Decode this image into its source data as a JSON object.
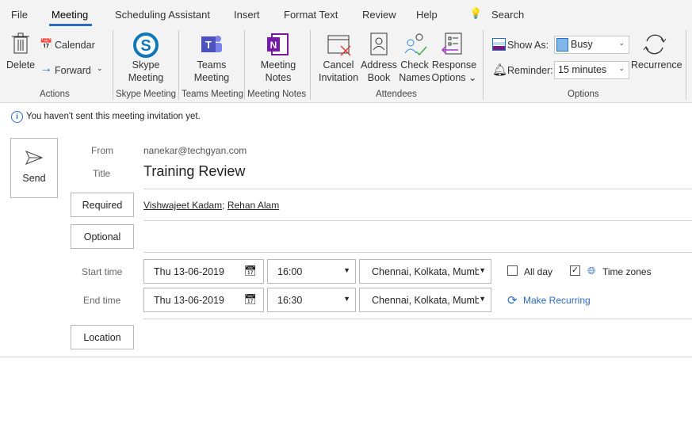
{
  "tabs": [
    "File",
    "Meeting",
    "Scheduling Assistant",
    "Insert",
    "Format Text",
    "Review",
    "Help"
  ],
  "search": "Search",
  "ribbon": {
    "delete": "Delete",
    "calendar": "Calendar",
    "forward": "Forward",
    "skype1": "Skype",
    "skype2": "Meeting",
    "teams1": "Teams",
    "teams2": "Meeting",
    "notes1": "Meeting",
    "notes2": "Notes",
    "cancel1": "Cancel",
    "cancel2": "Invitation",
    "address1": "Address",
    "address2": "Book",
    "check1": "Check",
    "check2": "Names",
    "resp1": "Response",
    "resp2": "Options",
    "show_as_label": "Show As:",
    "show_as_value": "Busy",
    "reminder_label": "Reminder:",
    "reminder_value": "15 minutes",
    "recurrence": "Recurrence",
    "groups": [
      "Actions",
      "Skype Meeting",
      "Teams Meeting",
      "Meeting Notes",
      "Attendees",
      "Options"
    ]
  },
  "info": "You haven't sent this meeting invitation yet.",
  "form": {
    "send": "Send",
    "from_label": "From",
    "from": "nanekar@techgyan.com",
    "title_label": "Title",
    "title": "Training Review",
    "required": "Required",
    "attendees": [
      "Vishwajeet Kadam",
      "Rehan Alam"
    ],
    "optional": "Optional",
    "start_label": "Start time",
    "start_date": "Thu 13-06-2019",
    "start_time": "16:00",
    "start_tz": "Chennai, Kolkata, Mumb",
    "end_label": "End time",
    "end_date": "Thu 13-06-2019",
    "end_time": "16:30",
    "end_tz": "Chennai, Kolkata, Mumb",
    "all_day": "All day",
    "all_day_checked": false,
    "time_zones": "Time zones",
    "time_zones_checked": true,
    "make_recurring": "Make Recurring",
    "location": "Location"
  },
  "colors": {
    "accent": "#2b6cc4",
    "busy": "#7fb7e8"
  }
}
